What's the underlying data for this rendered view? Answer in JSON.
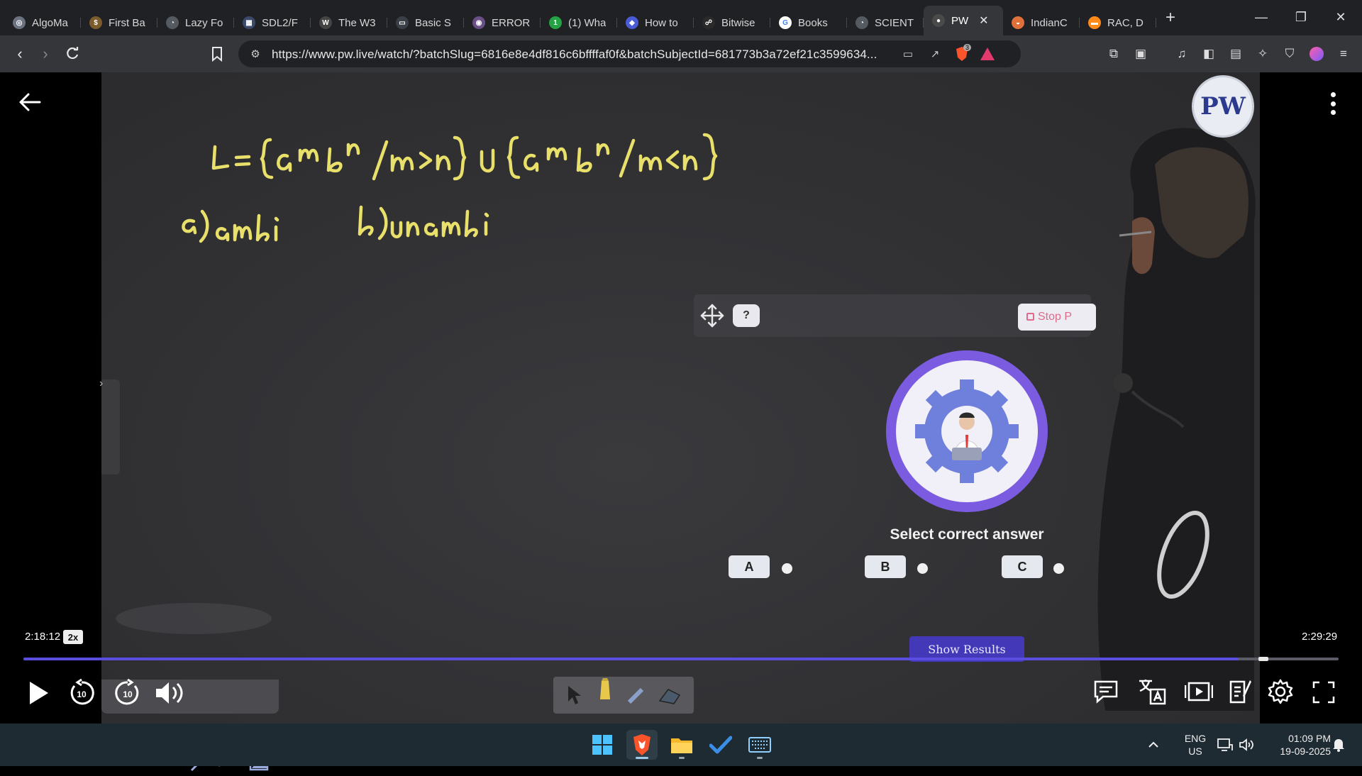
{
  "browser": {
    "tabs": [
      {
        "label": "AlgoMa",
        "fav_color": "#6b7280",
        "fav_glyph": "◎"
      },
      {
        "label": "First Ba",
        "fav_color": "#7c5c2c",
        "fav_glyph": "$"
      },
      {
        "label": "Lazy Fo",
        "fav_color": "#555a61",
        "fav_glyph": "◔"
      },
      {
        "label": "SDL2/F",
        "fav_color": "#3b4a6b",
        "fav_glyph": "▦"
      },
      {
        "label": "The W3",
        "fav_color": "#444",
        "fav_glyph": "W"
      },
      {
        "label": "Basic S",
        "fav_color": "#3a3f47",
        "fav_glyph": "▭"
      },
      {
        "label": "ERROR",
        "fav_color": "#6a4f86",
        "fav_glyph": "◉"
      },
      {
        "label": "(1) Wha",
        "fav_color": "#25a244",
        "fav_glyph": "1"
      },
      {
        "label": "How to",
        "fav_color": "#4b5bd6",
        "fav_glyph": "◆"
      },
      {
        "label": "Bitwise",
        "fav_color": "#2a2a2a",
        "fav_glyph": "☍"
      },
      {
        "label": "Books",
        "fav_color": "#ffffff",
        "fav_glyph": "G"
      },
      {
        "label": "SCIENT",
        "fav_color": "#555a61",
        "fav_glyph": "◔"
      },
      {
        "label": "PW",
        "fav_color": "#4a4a4a",
        "fav_glyph": "●",
        "active": true
      },
      {
        "label": "IndianC",
        "fav_color": "#e0703a",
        "fav_glyph": "◒"
      },
      {
        "label": "RAC, D",
        "fav_color": "#ff8c1a",
        "fav_glyph": "▬"
      }
    ],
    "url": "https://www.pw.live/watch/?batchSlug=6816e8e4df816c6bffffaf0f&batchSubjectId=681773b3a72ef21c3599634...",
    "brave_badge": "3"
  },
  "board": {
    "line1": "L = {aᵐbⁿ / m>n} ∪ {aᵐbⁿ / m<n}",
    "line2a": "a) ambi",
    "line2b": "b) unambi"
  },
  "poll": {
    "help": "?",
    "stop_label": "Stop P",
    "question": "Select correct answer",
    "options": [
      "A",
      "B",
      "C"
    ],
    "show_results": "Show Results"
  },
  "logo": "PW",
  "player": {
    "current_time": "2:18:12",
    "speed": "2x",
    "total_time": "2:29:29",
    "progress": 0.924,
    "skip_back": "10",
    "skip_fwd": "10"
  },
  "taskbar": {
    "lang_top": "ENG",
    "lang_bottom": "US",
    "time": "01:09 PM",
    "date": "19-09-2025"
  }
}
